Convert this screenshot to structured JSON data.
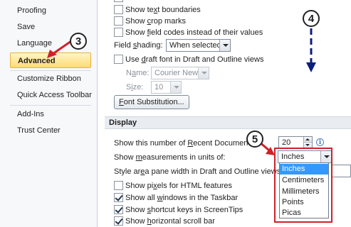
{
  "sidebar": {
    "items": [
      {
        "label": "Proofing"
      },
      {
        "label": "Save"
      },
      {
        "label": "Language"
      },
      {
        "label": "Advanced",
        "active": true
      },
      {
        "label": "Customize Ribbon"
      },
      {
        "label": "Quick Access Toolbar"
      },
      {
        "label": "Add-Ins"
      },
      {
        "label": "Trust Center"
      }
    ]
  },
  "show_document": {
    "text_boundaries": {
      "pre": "Show te",
      "key": "x",
      "post": "t boundaries",
      "checked": false
    },
    "crop_marks": {
      "pre": "Show ",
      "key": "c",
      "post": "rop marks",
      "checked": false
    },
    "field_codes": {
      "pre": "Show ",
      "key": "f",
      "post": "ield codes instead of their values",
      "checked": false
    },
    "field_shading": {
      "pre": "Field ",
      "key": "s",
      "post": "hading:",
      "value": "When selected"
    },
    "draft_font": {
      "pre": "Use ",
      "key": "d",
      "post": "raft font in Draft and Outline views",
      "checked": false
    },
    "font_name": {
      "pre": "N",
      "key": "a",
      "post": "me:",
      "value": "Courier New"
    },
    "font_size": {
      "pre": "S",
      "key": "i",
      "post": "ze:",
      "value": "10"
    },
    "font_substitution_button": {
      "pre": "",
      "key": "F",
      "post": "ont Substitution..."
    }
  },
  "display": {
    "heading": "Display",
    "recent_docs": {
      "pre": "Show this number of ",
      "key": "R",
      "post": "ecent Documents:",
      "value": "20"
    },
    "measurement": {
      "pre": "Show ",
      "key": "m",
      "post": "easurements in units of:",
      "value": "Inches"
    },
    "style_area": {
      "pre": "Style ar",
      "key": "e",
      "post": "a pane width in Draft and Outline views:"
    },
    "pixels_html": {
      "pre": "Show pi",
      "key": "x",
      "post": "els for HTML features",
      "checked": false
    },
    "all_windows": {
      "pre": "Show all ",
      "key": "w",
      "post": "indows in the Taskbar",
      "checked": true
    },
    "shortcut_keys": {
      "pre": "Show ",
      "key": "s",
      "post": "hortcut keys in ScreenTips",
      "checked": true
    },
    "horizontal_scroll": {
      "pre": "Show ",
      "key": "h",
      "post": "orizontal scroll bar",
      "checked": true
    },
    "units_options": [
      "Inches",
      "Centimeters",
      "Millimeters",
      "Points",
      "Picas"
    ]
  },
  "callouts": {
    "step3": "3",
    "step4": "4",
    "step5": "5"
  },
  "colors": {
    "accent": "#ffdb73",
    "annotation_red": "#d0202a",
    "selection": "#3399ff",
    "arrow_blue": "#0b1f7a"
  }
}
